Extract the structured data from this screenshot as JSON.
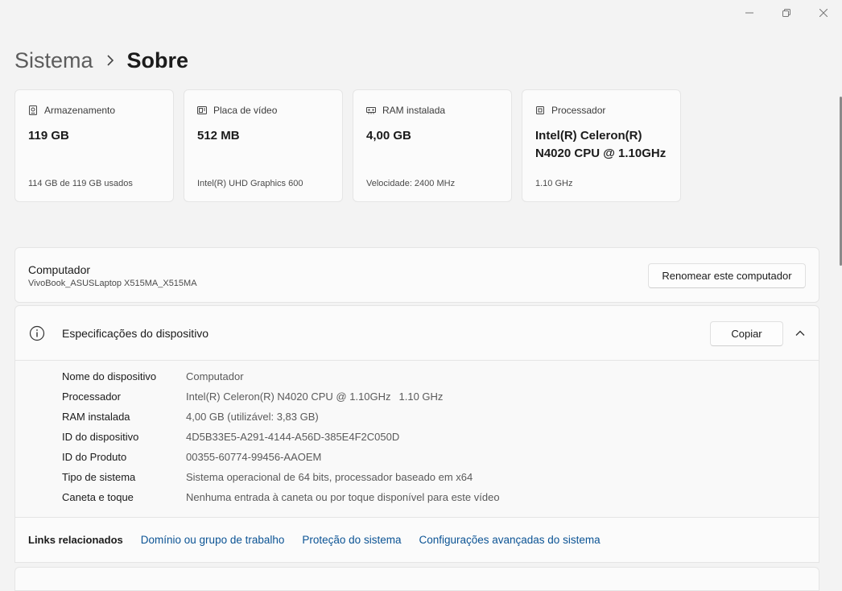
{
  "window": {
    "minimize_icon": "minimize-icon",
    "maximize_icon": "restore-icon",
    "close_icon": "close-icon"
  },
  "breadcrumb": {
    "parent": "Sistema",
    "current": "Sobre"
  },
  "cards": [
    {
      "icon": "storage-icon",
      "title": "Armazenamento",
      "value": "119 GB",
      "sub": "114 GB de 119 GB usados"
    },
    {
      "icon": "gpu-icon",
      "title": "Placa de vídeo",
      "value": "512 MB",
      "sub": "Intel(R) UHD Graphics 600"
    },
    {
      "icon": "ram-icon",
      "title": "RAM instalada",
      "value": "4,00 GB",
      "sub": "Velocidade: 2400 MHz"
    },
    {
      "icon": "cpu-icon",
      "title": "Processador",
      "value": "Intel(R) Celeron(R) N4020 CPU @ 1.10GHz",
      "sub": "1.10 GHz"
    }
  ],
  "computer": {
    "title": "Computador",
    "name": "VivoBook_ASUSLaptop X515MA_X515MA",
    "rename_label": "Renomear este computador"
  },
  "specs": {
    "title": "Especificações do dispositivo",
    "copy_label": "Copiar",
    "rows": [
      {
        "label": "Nome do dispositivo",
        "value": "Computador"
      },
      {
        "label": "Processador",
        "value": "Intel(R) Celeron(R) N4020 CPU @ 1.10GHz",
        "value2": "1.10 GHz"
      },
      {
        "label": "RAM instalada",
        "value": "4,00 GB (utilizável: 3,83 GB)"
      },
      {
        "label": "ID do dispositivo",
        "value": "4D5B33E5-A291-4144-A56D-385E4F2C050D"
      },
      {
        "label": "ID do Produto",
        "value": "00355-60774-99456-AAOEM"
      },
      {
        "label": "Tipo de sistema",
        "value": "Sistema operacional de 64 bits, processador baseado em x64"
      },
      {
        "label": "Caneta e toque",
        "value": "Nenhuma entrada à caneta ou por toque disponível para este vídeo"
      }
    ]
  },
  "related": {
    "label": "Links relacionados",
    "links": [
      "Domínio ou grupo de trabalho",
      "Proteção do sistema",
      "Configurações avançadas do sistema"
    ]
  }
}
